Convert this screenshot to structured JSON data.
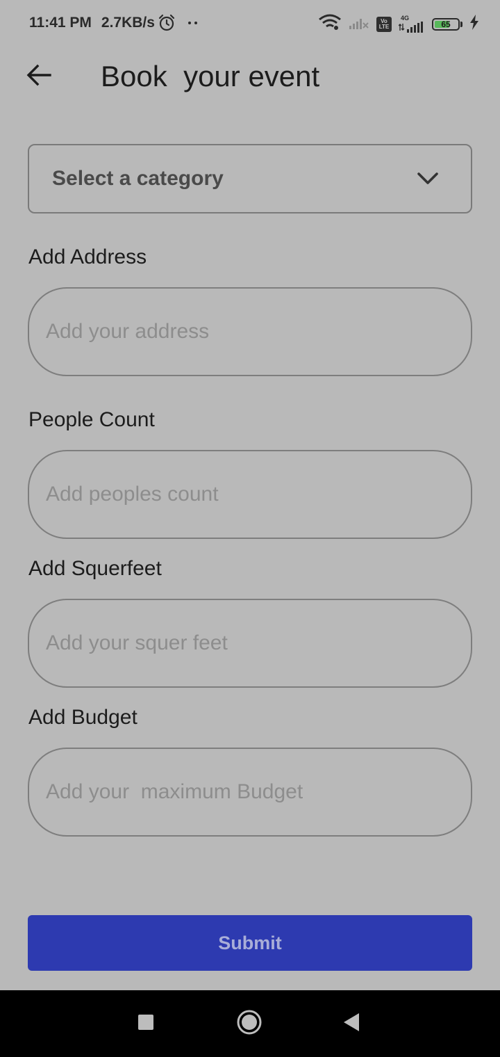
{
  "status_bar": {
    "time": "11:41 PM",
    "network_speed": "2.7KB/s",
    "battery_level": "65",
    "battery_fraction": 0.65,
    "network_label": "4G",
    "volte_label": "Vo LTE",
    "icons": [
      "alarm-icon",
      "wifi-icon",
      "signal-icon",
      "volte-icon",
      "signal-4g-icon",
      "battery-icon",
      "charging-icon"
    ]
  },
  "app_bar": {
    "back_icon": "arrow-left-icon",
    "title": "Book  your event"
  },
  "category": {
    "value": "Select a category",
    "icon": "chevron-down-icon"
  },
  "fields": [
    {
      "label": "Add Address",
      "placeholder": "Add your address"
    },
    {
      "label": "People Count",
      "placeholder": "Add peoples count"
    },
    {
      "label": "Add Squerfeet",
      "placeholder": "Add your squer feet"
    },
    {
      "label": "Add Budget",
      "placeholder": "Add your  maximum Budget"
    }
  ],
  "submit": {
    "label": "Submit",
    "color": "#2d3ab0"
  },
  "nav_bar": {
    "icons": [
      "recents-square-icon",
      "home-circle-icon",
      "back-triangle-icon"
    ]
  },
  "colors": {
    "background": "#b9b9b9",
    "accent": "#2d3ab0",
    "battery": "#58b85a"
  }
}
